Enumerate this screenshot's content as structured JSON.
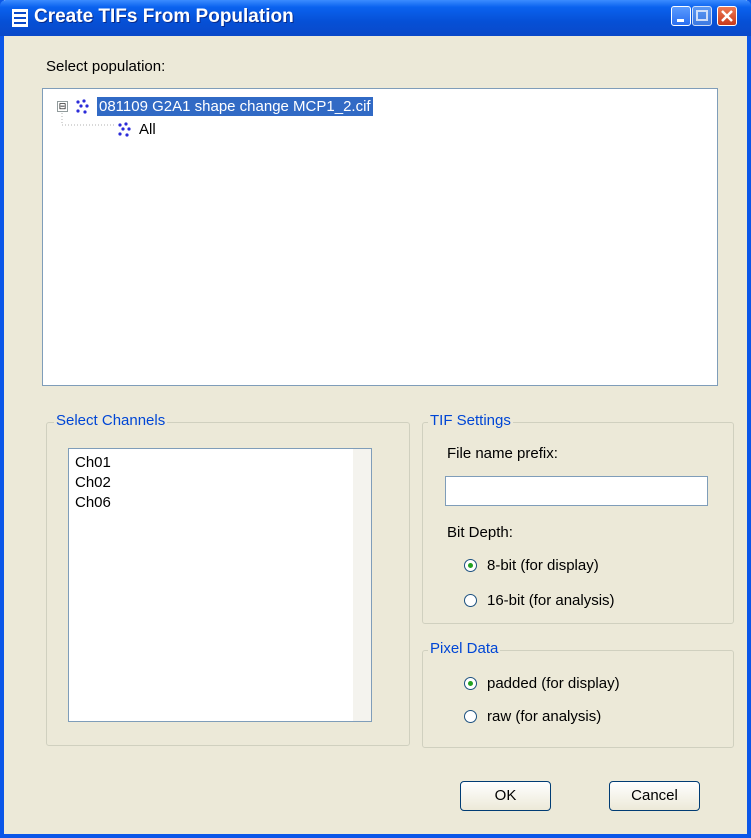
{
  "window": {
    "title": "Create TIFs From Population"
  },
  "population": {
    "label": "Select population:",
    "tree": {
      "root": {
        "label": "081109 G2A1 shape change MCP1_2.cif",
        "expander": "⊟"
      },
      "child": {
        "label": "All"
      }
    }
  },
  "channels": {
    "group_title": "Select Channels",
    "items": [
      "Ch01",
      "Ch02",
      "Ch06"
    ]
  },
  "tif_settings": {
    "group_title": "TIF Settings",
    "prefix_label": "File name prefix:",
    "prefix_value": "",
    "bit_depth_label": "Bit Depth:",
    "bit_depth_options": [
      {
        "label": "8-bit (for display)",
        "checked": true
      },
      {
        "label": "16-bit (for analysis)",
        "checked": false
      }
    ]
  },
  "pixel_data": {
    "group_title": "Pixel Data",
    "options": [
      {
        "label": "padded (for display)",
        "checked": true
      },
      {
        "label": "raw (for analysis)",
        "checked": false
      }
    ]
  },
  "buttons": {
    "ok": "OK",
    "cancel": "Cancel"
  },
  "colors": {
    "titlebar": "#0a56e8",
    "selection": "#316ac5",
    "group_title": "#0046d5",
    "dialog_bg": "#ece9d8"
  }
}
